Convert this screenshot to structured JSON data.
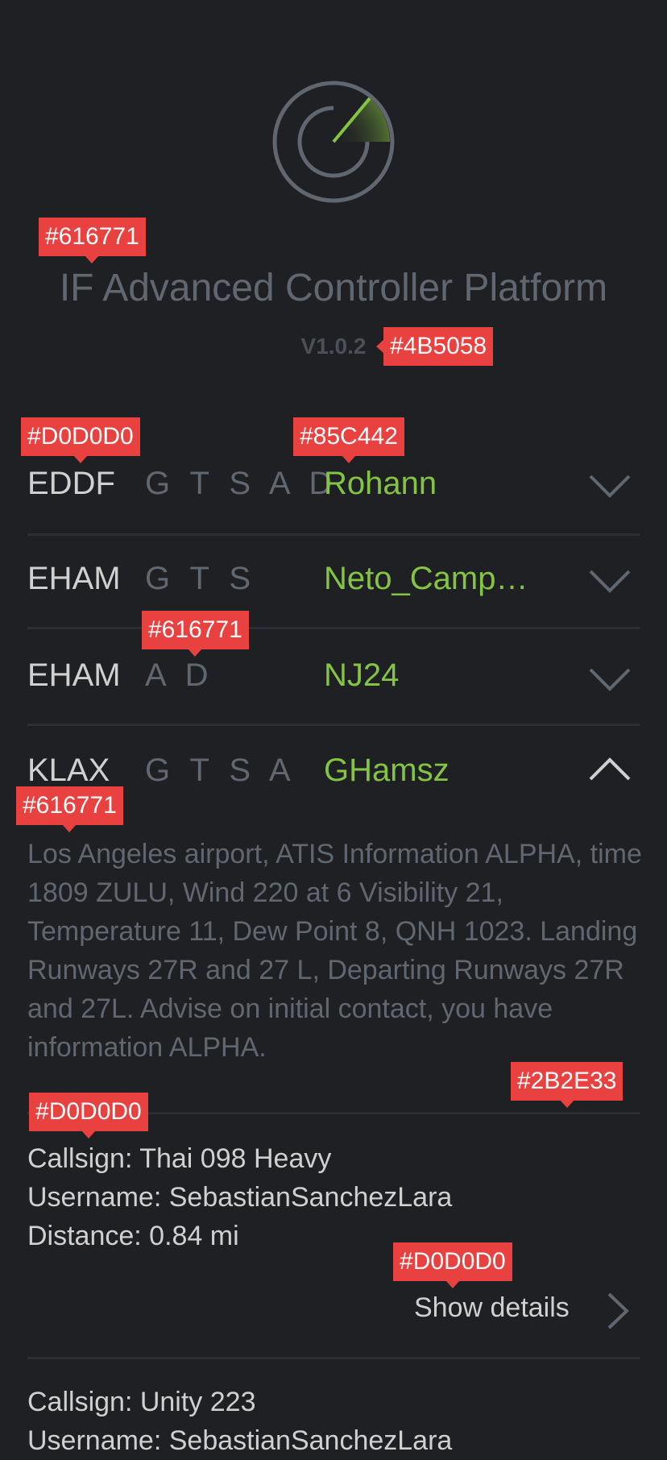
{
  "app": {
    "title": "IF Advanced Controller Platform",
    "version": "V1.0.2",
    "logo_icon": "radar-icon"
  },
  "airports": [
    {
      "icao": "EDDF",
      "services": "G T S A D",
      "controller": "Rohann",
      "expanded": false,
      "chevron": "chevron-down-icon"
    },
    {
      "icao": "EHAM",
      "services": "G T S",
      "controller": "Neto_Camp…",
      "expanded": false,
      "chevron": "chevron-down-icon"
    },
    {
      "icao": "EHAM",
      "services": "A D",
      "controller": "NJ24",
      "expanded": false,
      "chevron": "chevron-down-icon"
    },
    {
      "icao": "KLAX",
      "services": "G T S A",
      "controller": "GHamsz",
      "expanded": true,
      "chevron": "chevron-up-icon"
    }
  ],
  "atis": {
    "text": "Los Angeles airport, ATIS Information ALPHA, time 1809 ZULU, Wind 220 at 6 Visibility 21, Temperature 11, Dew Point 8, QNH 1023. Landing Runways 27R and 27 L, Departing Runways 27R and 27L. Advise on initial contact, you have information ALPHA."
  },
  "pilots": [
    {
      "callsign": "Callsign: Thai 098 Heavy",
      "username": "Username: SebastianSanchezLara",
      "distance": "Distance: 0.84 mi"
    },
    {
      "callsign": "Callsign: Unity 223",
      "username": "Username: SebastianSanchezLara"
    }
  ],
  "show_details": {
    "label": "Show details",
    "icon": "chevron-right-icon"
  },
  "color_tags": {
    "title": "#616771",
    "version": "#4B5058",
    "icao": "#D0D0D0",
    "controller": "#85C442",
    "services": "#616771",
    "atis": "#616771",
    "divider": "#2B2E33",
    "pilot": "#D0D0D0",
    "show_details": "#D0D0D0"
  },
  "colors": {
    "background": "#1F2023",
    "accent": "#85C442",
    "annotation_tag": "#E9413F"
  }
}
